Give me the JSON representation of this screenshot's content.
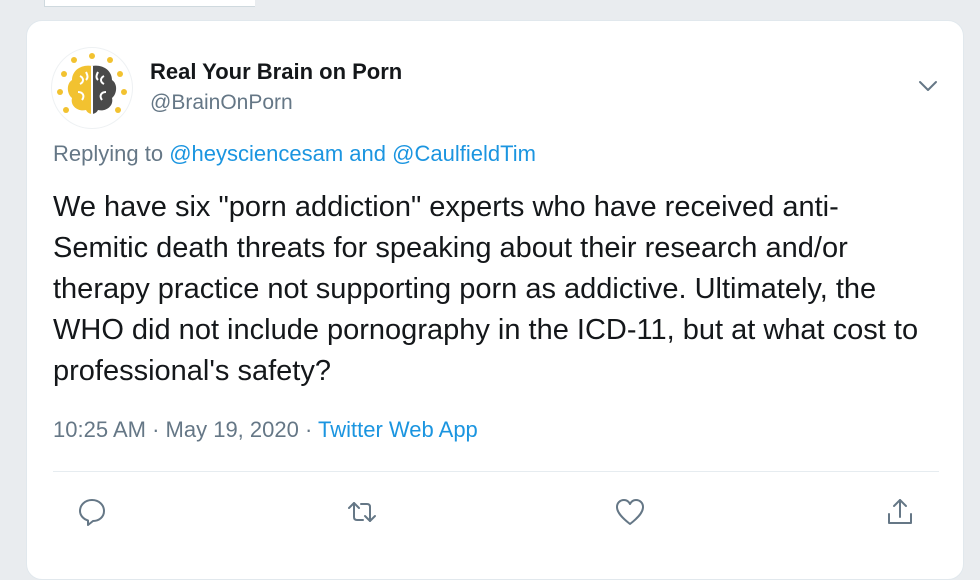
{
  "tweet": {
    "display_name": "Real Your Brain on Porn",
    "handle": "@BrainOnPorn",
    "replying_prefix": "Replying to",
    "reply_user_1": "@heysciencesam",
    "reply_and": "and",
    "reply_user_2": "@CaulfieldTim",
    "text": "We have six \"porn addiction\" experts who have received anti-Semitic death threats for speaking about their research and/or therapy practice not supporting porn as addictive. Ultimately, the WHO did not include pornography in the ICD-11, but at what cost to professional's safety?",
    "time": "10:25 AM",
    "separator": "·",
    "date": "May 19, 2020",
    "source_app": "Twitter Web App"
  },
  "actions": {
    "reply_icon": "speech-bubble",
    "retweet_icon": "retweet-arrows",
    "like_icon": "heart",
    "share_icon": "upload-arrow"
  },
  "colors": {
    "link": "#1b95e0",
    "secondary": "#657786",
    "primary_text": "#14171a",
    "brain_left": "#f2c230",
    "brain_right": "#4a4a4a"
  }
}
